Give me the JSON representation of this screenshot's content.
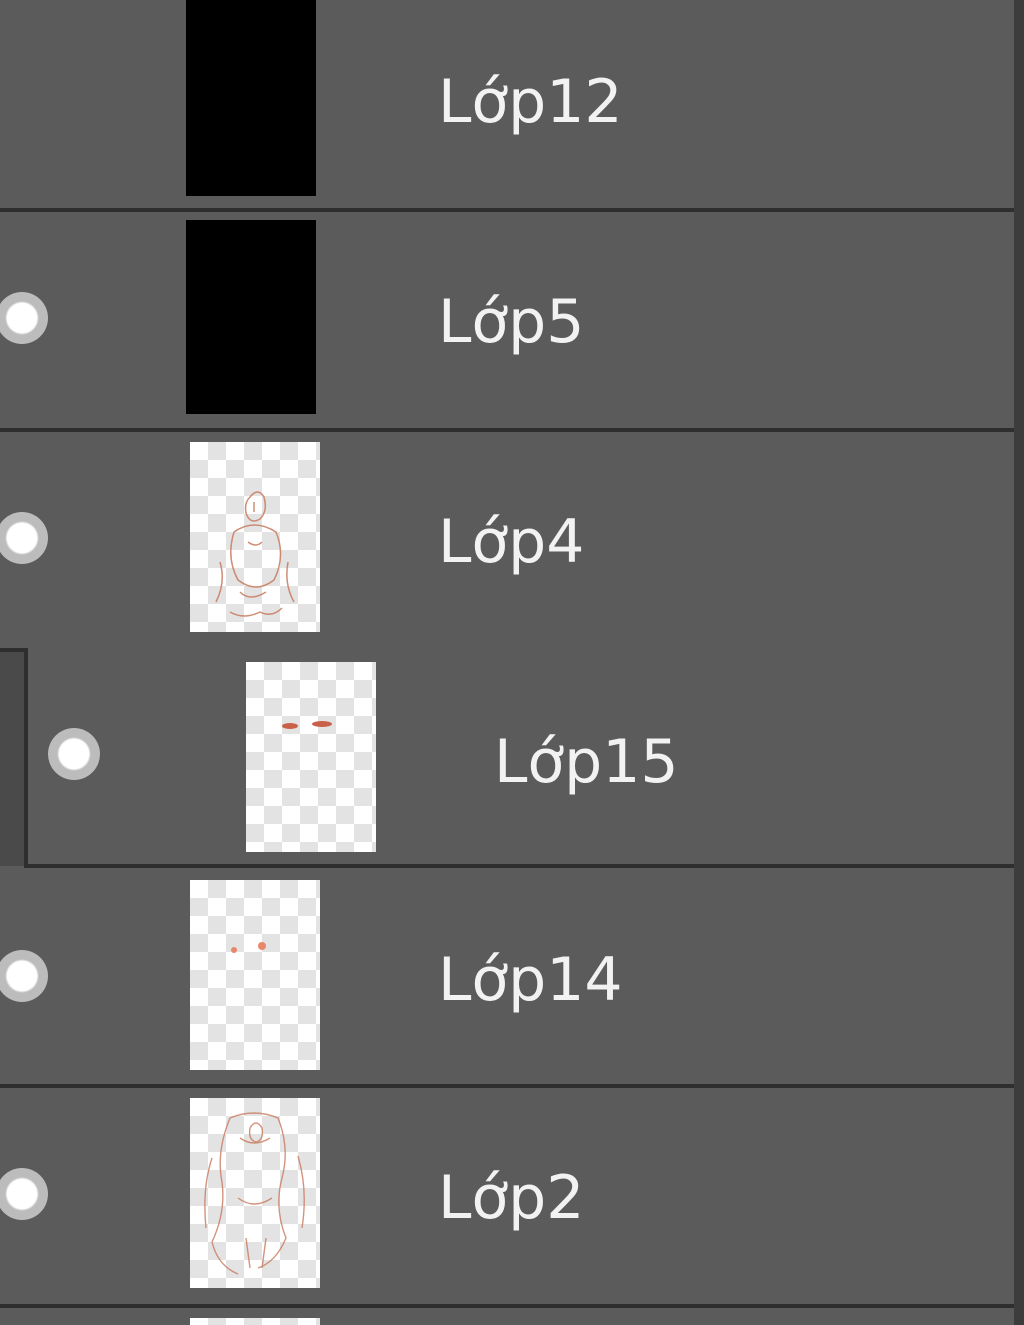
{
  "layers": [
    {
      "name": "Lớp12",
      "thumbnail": "black-fill",
      "visible_icon": "eye-dot-icon"
    },
    {
      "name": "Lớp5",
      "thumbnail": "black-fill",
      "visible_icon": "eye-dot-icon"
    },
    {
      "name": "Lớp4",
      "thumbnail": "transparent-sketch",
      "visible_icon": "eye-dot-icon"
    },
    {
      "name": "Lớp15",
      "thumbnail": "transparent-marks",
      "visible_icon": "eye-dot-icon",
      "clipped_child": true
    },
    {
      "name": "Lớp14",
      "thumbnail": "transparent-dots",
      "visible_icon": "eye-dot-icon"
    },
    {
      "name": "Lớp2",
      "thumbnail": "transparent-sketch",
      "visible_icon": "eye-dot-icon"
    }
  ],
  "colors": {
    "panel_bg": "#5b5b5b",
    "divider": "#2e2e2e",
    "label_text": "#f2f2f2",
    "sketch_stroke": "#c87a5e"
  }
}
